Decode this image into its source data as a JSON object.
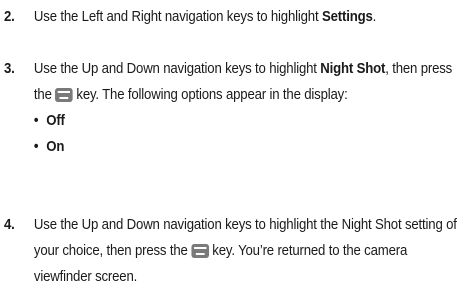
{
  "steps": [
    {
      "number": "2.",
      "t1": "Use the Left and Right navigation keys to highlight ",
      "b1": "Settings",
      "t2": "."
    },
    {
      "number": "3.",
      "t1": "Use the Up and Down navigation keys to highlight ",
      "b1": "Night Shot",
      "t2": ", then press the",
      "t3": "key. The following options appear in the display:",
      "options": [
        "Off",
        "On"
      ]
    },
    {
      "number": "4.",
      "t1": "Use the Up and Down navigation keys to highlight the Night Shot setting of your choice, then press the",
      "t2": "key. You’re returned to the camera viewfinder screen."
    }
  ],
  "key_icon": {
    "name": "menu-ok-key-icon",
    "color": "#7a7a7a",
    "text": "MENU OK"
  },
  "bullet_glyph": "•"
}
